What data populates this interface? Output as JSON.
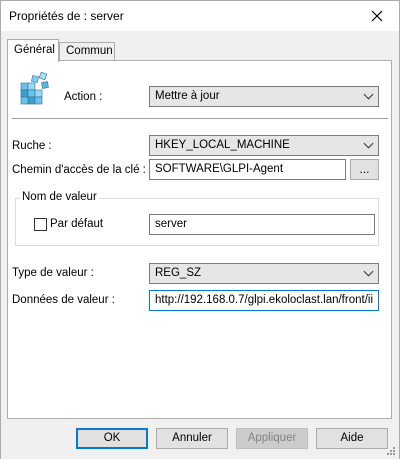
{
  "window": {
    "title": "Propriétés de : server"
  },
  "tabs": [
    {
      "label": "Général",
      "active": true
    },
    {
      "label": "Commun",
      "active": false
    }
  ],
  "icons": {
    "registry": "registry-icon",
    "close": "close-icon",
    "browse": "ellipsis-icon"
  },
  "action": {
    "label": "Action :",
    "value": "Mettre à jour"
  },
  "hive": {
    "label": "Ruche :",
    "value": "HKEY_LOCAL_MACHINE"
  },
  "keypath": {
    "label": "Chemin d'accès de la clé :",
    "value": "SOFTWARE\\GLPI-Agent",
    "browse_label": "..."
  },
  "value_name": {
    "group_label": "Nom de valeur",
    "default_label": "Par défaut",
    "default_checked": false,
    "value": "server"
  },
  "value_type": {
    "label": "Type de valeur :",
    "value": "REG_SZ"
  },
  "value_data": {
    "label": "Données de valeur :",
    "value": "http://192.168.0.7/glpi.ekoloclast.lan/front/ii"
  },
  "buttons": {
    "ok": "OK",
    "cancel": "Annuler",
    "apply": "Appliquer",
    "help": "Aide"
  },
  "colors": {
    "accent": "#0078d7",
    "panel": "#ffffff",
    "chrome": "#f0f0f0"
  }
}
